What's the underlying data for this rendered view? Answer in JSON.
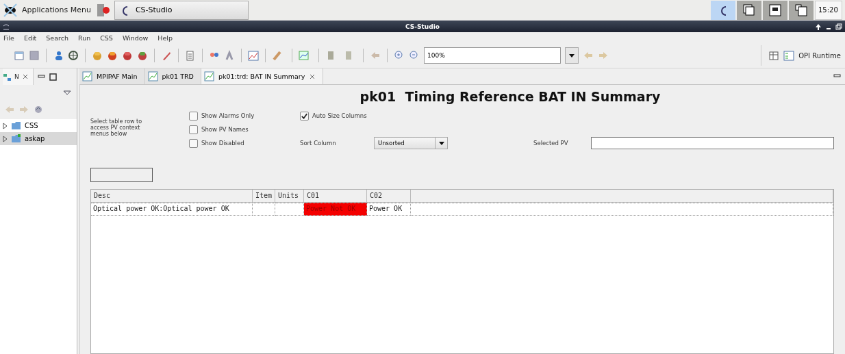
{
  "taskbar": {
    "menu_label": "Applications Menu",
    "task": "CS-Studio",
    "time": "15:20"
  },
  "window": {
    "title": "CS-Studio"
  },
  "menu": [
    "File",
    "Edit",
    "Search",
    "Run",
    "CSS",
    "Window",
    "Help"
  ],
  "toolbar": {
    "zoom": "100%",
    "perspective": "OPI Runtime"
  },
  "navigator": {
    "tab": "N",
    "items": [
      {
        "label": "CSS",
        "selected": false
      },
      {
        "label": "askap",
        "selected": true
      }
    ]
  },
  "editor_tabs": [
    {
      "label": "MPIPAF Main",
      "selected": false
    },
    {
      "label": "pk01 TRD",
      "selected": false
    },
    {
      "label": "pk01:trd: BAT IN Summary",
      "selected": true
    }
  ],
  "display": {
    "title": "pk01  Timing Reference BAT IN Summary",
    "hint": "Select table row to access PV context menus below",
    "checkboxes": [
      {
        "label": "Show Alarms Only",
        "checked": false
      },
      {
        "label": "Show PV Names",
        "checked": false
      },
      {
        "label": "Show Disabled",
        "checked": false
      },
      {
        "label": "Auto Size Columns",
        "checked": true
      }
    ],
    "sort_label": "Sort Column",
    "sort_value": "Unsorted",
    "selected_pv_label": "Selected PV"
  },
  "table": {
    "columns": [
      "Desc",
      "Item",
      "Units",
      "C01",
      "C02"
    ],
    "rows": [
      [
        {
          "text": "Optical power OK:Optical power OK",
          "alarm": false
        },
        {
          "text": "",
          "alarm": false
        },
        {
          "text": "",
          "alarm": false
        },
        {
          "text": "Power Not OK",
          "alarm": true
        },
        {
          "text": "Power OK",
          "alarm": false
        }
      ]
    ]
  }
}
